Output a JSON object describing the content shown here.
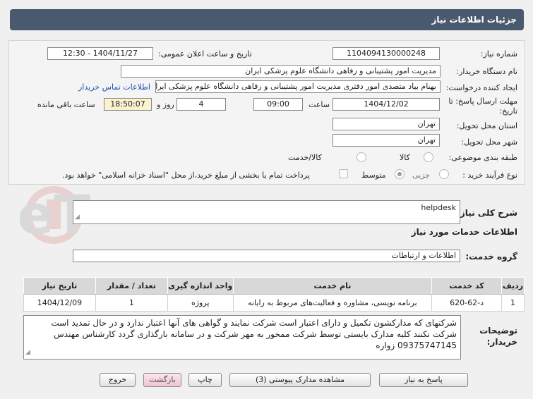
{
  "header": {
    "title": "جزئیات اطلاعات نیاز"
  },
  "form": {
    "need_number_label": "شماره نیاز:",
    "need_number": "1104094130000248",
    "announce_label": "تاریخ و ساعت اعلان عمومی:",
    "announce_value": "1404/11/27 - 12:30",
    "buyer_org_label": "نام دستگاه خریدار:",
    "buyer_org": "مدیریت امور پشتیبانی و رفاهی دانشگاه علوم پزشکی ایران",
    "requester_label": "ایجاد کننده درخواست:",
    "requester": "بهنام بیاد متصدی امور دفتری مدیریت امور پشتیبانی و رفاهی دانشگاه علوم پزشکی ایران",
    "contact_link": "اطلاعات تماس خریدار",
    "deadline_label_1": "مهلت ارسال پاسخ: تا",
    "deadline_label_2": "تاریخ:",
    "deadline_date": "1404/12/02",
    "time_label": "ساعت",
    "deadline_time": "09:00",
    "days": "4",
    "days_label": "روز و",
    "remaining_time": "18:50:07",
    "remaining_label": "ساعت باقی مانده",
    "province_label": "استان محل تحویل:",
    "province": "تهران",
    "city_label": "شهر محل تحویل:",
    "city": "تهران",
    "category_label": "طبقه بندی موضوعی:",
    "category_options": [
      "کالا",
      "کالا/خدمت"
    ],
    "purchase_type_label": "نوع فرآیند خرید :",
    "purchase_options": [
      "جزیی",
      "متوسط"
    ],
    "payment_note": "پرداخت تمام یا بخشی از مبلغ خرید،از محل \"اسناد خزانه اسلامی\" خواهد بود."
  },
  "summary": {
    "label": "شرح کلی نیاز:",
    "value": "helpdesk"
  },
  "services": {
    "section_title": "اطلاعات خدمات مورد نیاز",
    "group_label": "گروه خدمت:",
    "group_value": "اطلاعات و ارتباطات",
    "columns": [
      "ردیف",
      "کد خدمت",
      "نام خدمت",
      "واحد اندازه گیری",
      "تعداد / مقدار",
      "تاریخ نیاز"
    ],
    "rows": [
      [
        "1",
        "د-62-620",
        "برنامه نویسی، مشاوره و فعالیت‌های مربوط به رایانه",
        "پروژه",
        "1",
        "1404/12/09"
      ]
    ]
  },
  "notes": {
    "label_1": "توضیحات",
    "label_2": "خریدار:",
    "value": "شرکتهای که مدارکشون تکمیل و دارای اعتبار است شرکت نمایند و گواهی های آنها اعتبار ندارد و در حال تمدید است شرکت نکنند کلیه مدارک بایستی توسط شرکت ممحور به مهر شرکت و در سامانه بارگذاری گردد کارشناس مهندس 09375747145 زواره"
  },
  "buttons": {
    "reply": "پاسخ به نیاز",
    "attachments": "مشاهده مدارک پیوستی (3)",
    "print": "چاپ",
    "back": "بازگشت",
    "exit": "خروج"
  },
  "watermark": {
    "text": "AriaTender.neT"
  },
  "colors": {
    "header_bg": "#4a5a6e",
    "link": "#1a4fb7",
    "time_bg": "#fbf3cf"
  }
}
